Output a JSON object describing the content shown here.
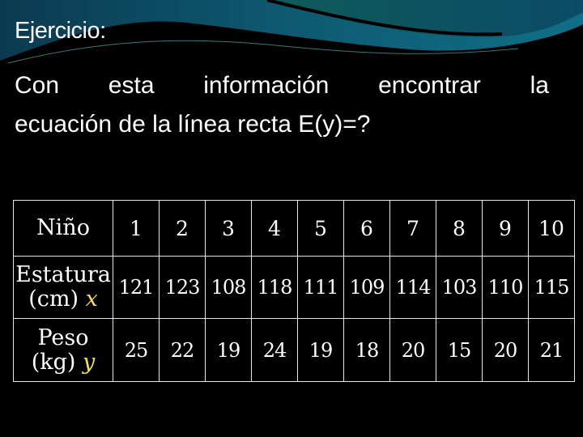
{
  "slide": {
    "title": "Ejercicio:",
    "body_line1_words": [
      "Con",
      "esta",
      "información",
      "encontrar",
      "la"
    ],
    "body_line2": "ecuación de la línea recta E(y)=?"
  },
  "table": {
    "header": {
      "label": "Niño",
      "values": [
        "1",
        "2",
        "3",
        "4",
        "5",
        "6",
        "7",
        "8",
        "9",
        "10"
      ]
    },
    "rows": [
      {
        "label_line1": "Estatura",
        "label_line2": "(cm)",
        "variable": "x",
        "values": [
          "121",
          "123",
          "108",
          "118",
          "111",
          "109",
          "114",
          "103",
          "110",
          "115"
        ]
      },
      {
        "label_line1": "Peso",
        "label_line2": "(kg)",
        "variable": "y",
        "values": [
          "25",
          "22",
          "19",
          "24",
          "19",
          "18",
          "20",
          "15",
          "20",
          "21"
        ]
      }
    ]
  },
  "colors": {
    "background": "#000000",
    "text": "#ffffff",
    "variable": "#f2e24a",
    "accent": "#0e6b84"
  }
}
